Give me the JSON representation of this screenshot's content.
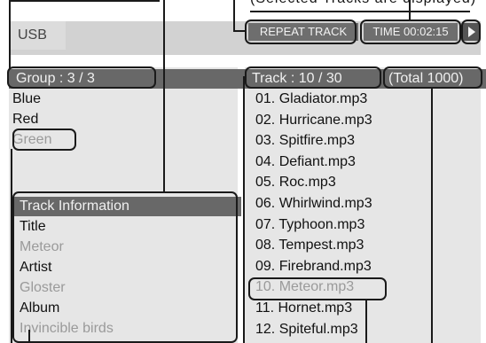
{
  "top_label": "(Selected Tracks are displayed)",
  "header": {
    "source": "USB",
    "repeat_mode": "REPEAT TRACK",
    "time": "TIME 00:02:15",
    "play_icon": "play-icon"
  },
  "group_panel": {
    "title": "Group  :  3 / 3",
    "items": [
      "Blue",
      "Red",
      "Green"
    ],
    "selected_index": 2
  },
  "track_info": {
    "title": "Track  Information",
    "rows": [
      "Title",
      "Meteor",
      "Artist",
      "Gloster",
      "Album",
      "Invincible birds"
    ]
  },
  "track_panel": {
    "title": "Track  :  10  /  30",
    "total": "(Total  1000)",
    "items": [
      "01. Gladiator.mp3",
      "02. Hurricane.mp3",
      "03. Spitfire.mp3",
      "04. Defiant.mp3",
      "05. Roc.mp3",
      "06. Whirlwind.mp3",
      "07. Typhoon.mp3",
      "08. Tempest.mp3",
      "09. Firebrand.mp3",
      "10. Meteor.mp3",
      "11. Hornet.mp3",
      "12. Spiteful.mp3"
    ],
    "selected_index": 9
  }
}
